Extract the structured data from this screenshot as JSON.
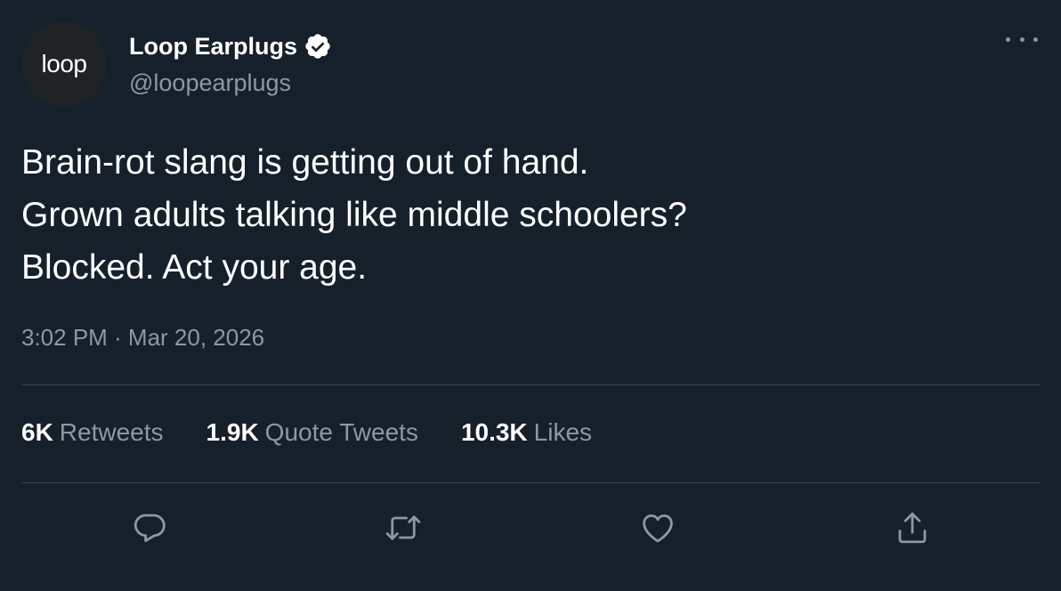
{
  "author": {
    "avatar_text": "loop",
    "display_name": "Loop Earplugs",
    "handle": "@loopearplugs",
    "verified": true,
    "verified_icon": "verified-badge-icon"
  },
  "tweet": {
    "lines": [
      "Brain-rot slang is getting out of hand.",
      "Grown adults talking like middle schoolers?",
      "Blocked. Act your age."
    ],
    "timestamp": "3:02 PM · Mar 20, 2026"
  },
  "stats": [
    {
      "count": "6K",
      "label": "Retweets"
    },
    {
      "count": "1.9K",
      "label": "Quote Tweets"
    },
    {
      "count": "10.3K",
      "label": "Likes"
    }
  ],
  "actions": [
    {
      "name": "reply",
      "icon": "reply-icon"
    },
    {
      "name": "retweet",
      "icon": "retweet-icon"
    },
    {
      "name": "like",
      "icon": "heart-icon"
    },
    {
      "name": "share",
      "icon": "share-icon"
    }
  ],
  "colors": {
    "background": "#15202b",
    "text_primary": "#ffffff",
    "text_secondary": "#8b98a5",
    "divider": "#38444d",
    "avatar_bg": "#202326"
  }
}
